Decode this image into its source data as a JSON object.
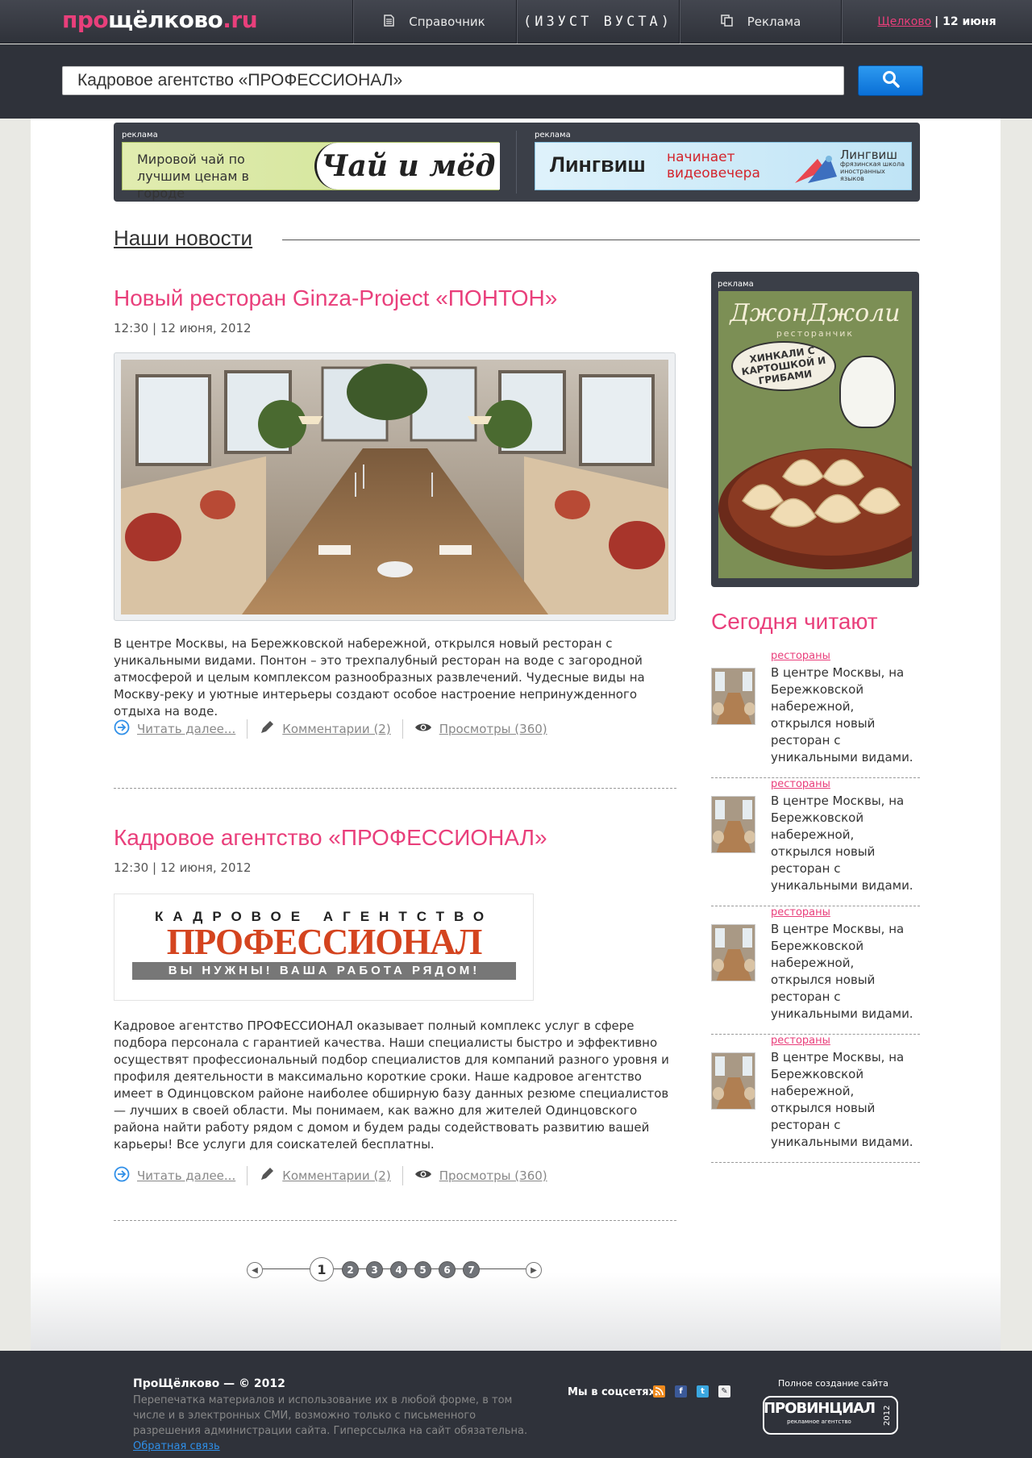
{
  "header": {
    "logo": {
      "part1": "про",
      "part2": "щёлково",
      "part3": ".ru"
    },
    "nav": [
      {
        "label": "Справочник",
        "icon": "document-icon"
      },
      {
        "label": "(ИЗУСТ ВУСТА)",
        "icon": ""
      },
      {
        "label": "Реклама",
        "icon": "copy-icon"
      }
    ],
    "city_link": "Щелково",
    "date": "| 12 июня"
  },
  "search": {
    "value": "Кадровое агентство «ПРОФЕССИОНАЛ»",
    "button_icon": "search-icon"
  },
  "ads_top": [
    {
      "label": "реклама",
      "text": "Мировой чай по лучшим ценам в городе",
      "brand": "Чай и мёд"
    },
    {
      "label": "реклама",
      "brand": "Лингвиш",
      "text": "начинает видеовечера",
      "side_brand": "Лингвиш",
      "side_sub": "фрязинская школа иностранных языков"
    }
  ],
  "section_title": "Наши новости",
  "news": [
    {
      "title": "Новый ресторан Ginza-Project «ПОНТОН»",
      "date": "12:30 | 12 июня, 2012",
      "text": "В центре Москвы, на Бережковской набережной, открылся новый ресторан с уникальными видами. Понтон – это трехпалубный ресторан на воде с загородной атмосферой и целым комплексом разнообразных развлечений. Чудесные виды на Москву-реку и уютные интерьеры создают особое настроение непринужденного отдыха на воде.",
      "read_more": "Читать далее...",
      "comments": "Комментарии (2)",
      "views": "Просмотры (360)"
    },
    {
      "title": "Кадровое агентство «ПРОФЕССИОНАЛ»",
      "date": "12:30 | 12 июня, 2012",
      "logo_top": "КАДРОВОЕ АГЕНТСТВО",
      "logo_main": "ПРОФЕССИОНАЛ",
      "logo_sub": "ВЫ НУЖНЫ! ВАША РАБОТА РЯДОМ!",
      "text": "Кадровое агентство ПРОФЕССИОНАЛ оказывает полный комплекс услуг в сфере подбора персонала с гарантией качества. Наши специалисты быстро и эффективно осуществят профессиональный подбор специалистов для компаний разного уровня и профиля деятельности в максимально короткие сроки. Наше кадровое агентство имеет в Одинцовском районе наиболее обширную базу данных резюме специалистов — лучших в своей области. Мы понимаем, как важно для жителей Одинцовского района найти работу рядом с домом и будем рады содействовать развитию вашей карьеры! Все услуги для соискателей бесплатны.",
      "read_more": "Читать далее...",
      "comments": "Комментарии (2)",
      "views": "Просмотры (360)"
    }
  ],
  "side_ad": {
    "label": "реклама",
    "brand": "ДжонДжоли",
    "sub": "ресторанчик",
    "bubble": "ХИНКАЛИ С КАРТОШКОЙ И ГРИБАМИ"
  },
  "today": {
    "title": "Сегодня читают",
    "items": [
      {
        "category": "рестораны",
        "text": "В центре Москвы, на Бережковской набережной, открылся новый ресторан с уникальными видами."
      },
      {
        "category": "рестораны",
        "text": "В центре Москвы, на Бережковской набережной, открылся новый ресторан с уникальными видами."
      },
      {
        "category": "рестораны",
        "text": "В центре Москвы, на Бережковской набережной, открылся новый ресторан с уникальными видами."
      },
      {
        "category": "рестораны",
        "text": "В центре Москвы, на Бережковской набережной, открылся новый ресторан с уникальными видами."
      }
    ]
  },
  "pagination": {
    "current": "1",
    "pages": [
      "2",
      "3",
      "4",
      "5",
      "6",
      "7"
    ],
    "prev": "◀",
    "next": "▶"
  },
  "footer": {
    "copyright": "ПроЩёлково — © 2012",
    "text": "Перепечатка материалов и использование их в любой форме, в том числе и в электронных СМИ, возможно только с письменного разрешения администрации сайта. Гиперссылка на сайт обязательна.",
    "feedback": "Обратная связь",
    "social_label": "Мы в соцсетях:",
    "made_by": "Полное создание сайта",
    "agency": "ПРОВИНЦИАЛ",
    "agency_sub": "рекламное агентство",
    "agency_year": "2012"
  },
  "colors": {
    "accent": "#e93f7b",
    "dark": "#2f323a",
    "button": "#1a80e4"
  }
}
